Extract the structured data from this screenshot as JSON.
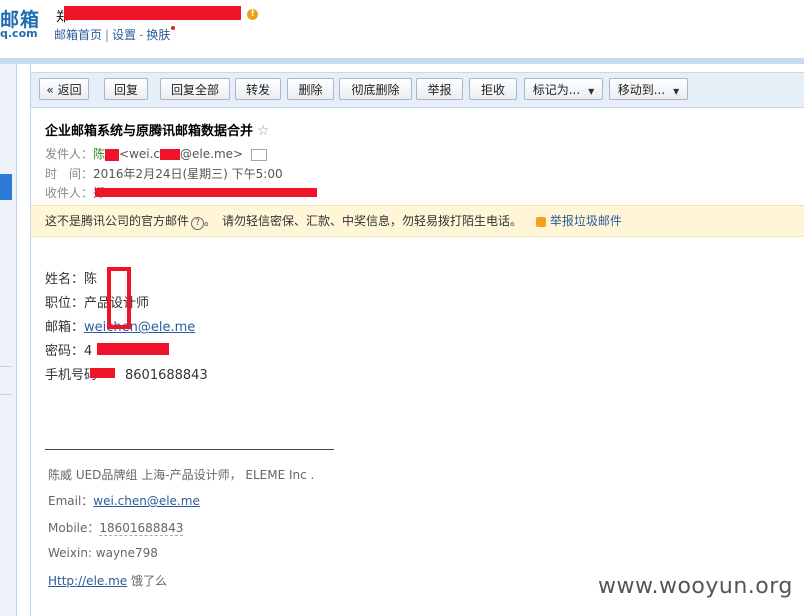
{
  "header": {
    "logo_text": "邮箱",
    "logo_domain": "q.com",
    "user_name": "郑",
    "warning_icon": "warning-icon",
    "links": {
      "home": "邮箱首页",
      "settings": "设置",
      "skin": "换肤",
      "sep1": "|",
      "sep2": "-"
    }
  },
  "toolbar": {
    "back": "« 返回",
    "reply": "回复",
    "reply_all": "回复全部",
    "forward": "转发",
    "delete": "删除",
    "perm_delete": "彻底删除",
    "report": "举报",
    "reject": "拒收",
    "mark_as": "标记为...",
    "move_to": "移动到..."
  },
  "mail": {
    "subject": "企业邮箱系统与原腾讯邮箱数据合并",
    "star": "☆",
    "from_label": "发件人：",
    "from_name": "陈",
    "from_email_pre": "<wei.c",
    "from_email_post": "@ele.me>",
    "time_label": "时　间：",
    "time_value": "2016年2月24日(星期三) 下午5:00",
    "to_label": "收件人：",
    "to_value": "郑"
  },
  "warning": {
    "text1": "这不是腾讯公司的官方邮件",
    "text2": "。　请勿轻信密保、汇款、中奖信息，勿轻易拨打陌生电话。",
    "qmark": "?",
    "report_link": "举报垃圾邮件"
  },
  "body": {
    "name_label": "姓名：",
    "name_value": "陈",
    "title_label": "职位：",
    "title_value": "产品设计师",
    "email_label": "邮箱：",
    "email_value": "weichen@ele.me",
    "pwd_label": "密码：",
    "pwd_value": "4",
    "phone_label": "手机号码",
    "phone_value": "8601688843"
  },
  "signature": {
    "line1": "陈威  UED品牌组 上海-产品设计师，  ELEME Inc .",
    "email_label": "Email：",
    "email_value": "wei.chen@ele.me",
    "mobile_label": "Mobile：",
    "mobile_value": "18601688843",
    "weixin": "Weixin: wayne798",
    "site_link": "Http://ele.me",
    "site_suffix": " 饿了么"
  },
  "watermark": "www.wooyun.org",
  "colors": {
    "accent": "#1f6db3",
    "redact": "#f0142a",
    "warn_bg": "#fff6d8",
    "toolbar_bg": "#e6eef7"
  }
}
